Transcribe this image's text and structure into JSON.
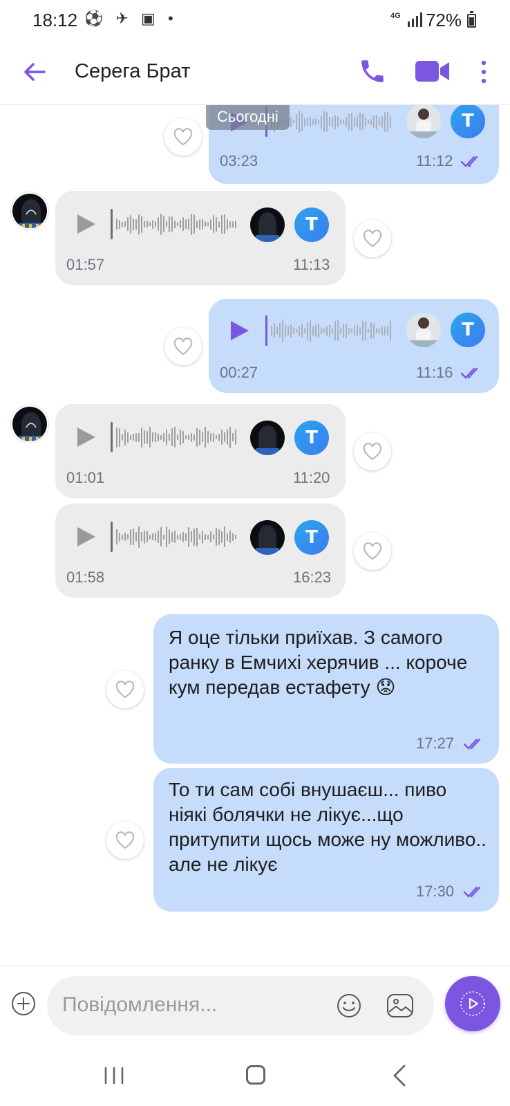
{
  "status_bar": {
    "time": "18:12",
    "notification_icons": "⚽ ✈ ▣ •",
    "network": "4G",
    "battery": "72%",
    "battery_level": 0.72
  },
  "header": {
    "title": "Серега Брат",
    "icons": [
      "back-arrow-icon",
      "phone-icon",
      "video-icon",
      "more-vertical-icon"
    ]
  },
  "date_chip": "Сьогодні",
  "messages": [
    {
      "direction": "out",
      "type": "voice",
      "duration": "03:23",
      "time": "11:12",
      "read": true
    },
    {
      "direction": "in",
      "type": "voice",
      "duration": "01:57",
      "time": "11:13"
    },
    {
      "direction": "out",
      "type": "voice",
      "duration": "00:27",
      "time": "11:16",
      "read": true
    },
    {
      "direction": "in",
      "type": "voice",
      "duration": "01:01",
      "time": "11:20"
    },
    {
      "direction": "in",
      "type": "voice",
      "duration": "01:58",
      "time": "16:23"
    },
    {
      "direction": "out",
      "type": "text",
      "text": "Я оце тільки приїхав. З самого ранку в Емчихі херячив ... короче кум передав естафету 😟",
      "time": "17:27",
      "read": true
    },
    {
      "direction": "out",
      "type": "text",
      "text": "То ти сам собі внушаєш... пиво ніякі болячки не лікує...що притупити щось може ну можливо.. але не лікує",
      "time": "17:30",
      "read": true
    }
  ],
  "badge_letter": "T",
  "composer": {
    "placeholder": "Повідомлення..."
  },
  "colors": {
    "accent": "#7b56e0",
    "outgoing_bubble": "#c6dcfb",
    "incoming_bubble": "#ececec"
  }
}
